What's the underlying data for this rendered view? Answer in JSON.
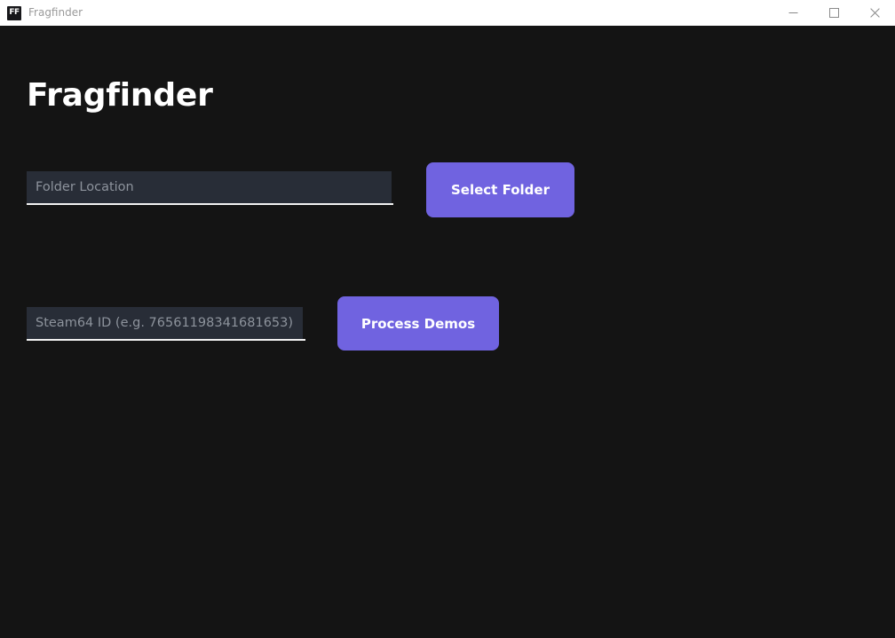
{
  "window": {
    "app_icon_text": "FF",
    "title": "Fragfinder",
    "controls": {
      "minimize": "minimize-icon",
      "maximize": "maximize-icon",
      "close": "close-icon"
    }
  },
  "main": {
    "heading": "Fragfinder",
    "fields": {
      "folder_location": {
        "placeholder": "Folder Location",
        "value": ""
      },
      "steam_id": {
        "placeholder": "Steam64 ID (e.g. 76561198341681653)",
        "value": ""
      }
    },
    "buttons": {
      "select_folder": "Select Folder",
      "process_demos": "Process Demos"
    }
  },
  "theme": {
    "background": "#141414",
    "titlebar_background": "#ffffff",
    "titlebar_text": "#9a9a9a",
    "accent": "#7063e0",
    "field_fill": "#282d37",
    "field_underline": "#f2f2f2",
    "placeholder_text": "#8d939c",
    "heading_text": "#ffffff"
  }
}
